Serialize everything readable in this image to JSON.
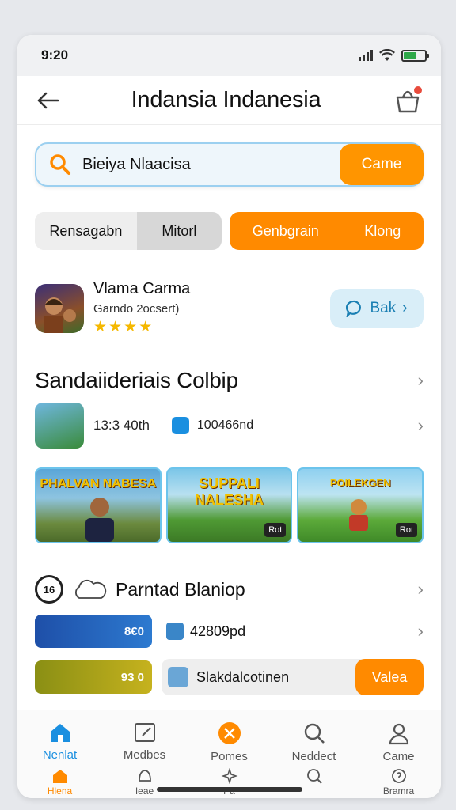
{
  "status": {
    "time": "9:20"
  },
  "header": {
    "title": "Indansia Indanesia"
  },
  "search": {
    "query": "Bieiya Nlaacisa",
    "button_label": "Came"
  },
  "segments": {
    "left_a": "Rensagabn",
    "left_b": "Mitorl",
    "right_a": "Genbgrain",
    "right_b": "Klong"
  },
  "game": {
    "name": "Vlama Carma",
    "subtitle": "Garndo 2ocsert)",
    "rating": 4,
    "button_label": "Bak"
  },
  "section1": {
    "title": "Sandaiideriais Colbip",
    "stat1": "13:3 40th",
    "stat2": "100466nd",
    "banners": [
      {
        "caption": "PHALVAN NABESA",
        "badge": ""
      },
      {
        "caption": "SUPPALI NALESHA",
        "badge": "Rot"
      },
      {
        "caption": "POILEKGEN",
        "badge": "Rot"
      }
    ]
  },
  "section2": {
    "badge_text": "16",
    "title": "Parntad Blaniop",
    "row1_banner": "8€0",
    "row1_text": "42809pd",
    "row2_banner": "93 0",
    "row2_text": "Slakdalcotinen",
    "row2_button": "Valea"
  },
  "tabbar": {
    "tabs": [
      {
        "label": "Nenlat",
        "icon": "home-icon"
      },
      {
        "label": "Medbes",
        "icon": "edit-icon"
      },
      {
        "label": "Pomes",
        "icon": "close-circle-icon"
      },
      {
        "label": "Neddect",
        "icon": "search-icon"
      },
      {
        "label": "Came",
        "icon": "user-icon"
      }
    ],
    "tabs2": [
      {
        "label": "Hlena",
        "icon": "home-icon"
      },
      {
        "label": "Ieae",
        "icon": "bell-icon"
      },
      {
        "label": "Pa",
        "icon": "sparkle-icon"
      },
      {
        "label": "",
        "icon": "search-icon"
      },
      {
        "label": "Bramra",
        "icon": "info-icon"
      }
    ]
  },
  "colors": {
    "accent_orange": "#ff8a00",
    "accent_blue": "#1a8fe0",
    "badge_red": "#e84b3c"
  }
}
